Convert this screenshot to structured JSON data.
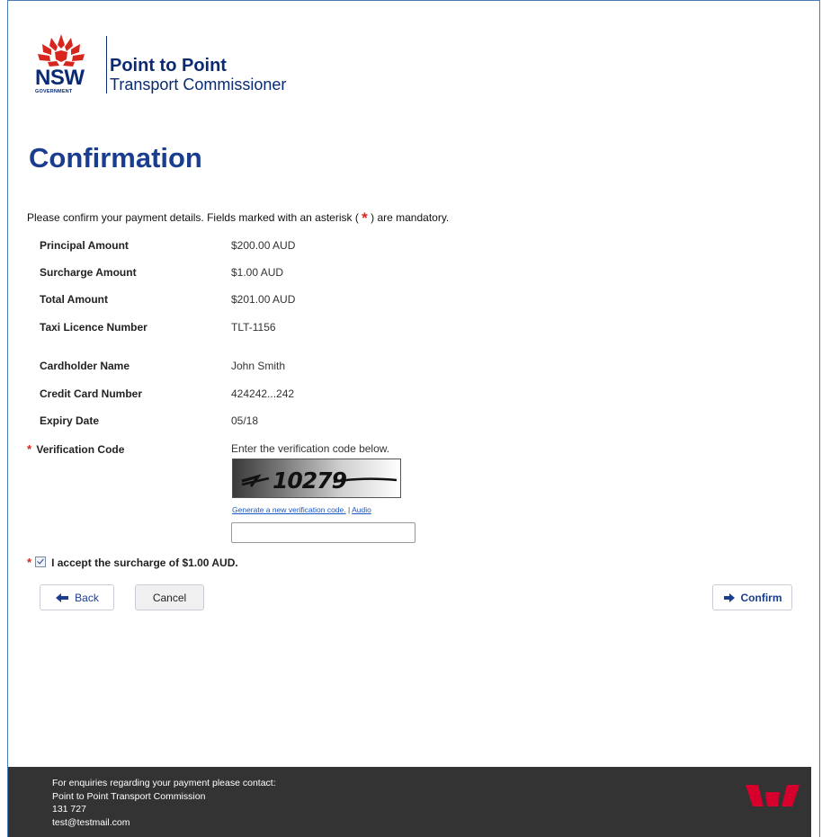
{
  "header": {
    "logo_nsw": "NSW",
    "logo_government": "GOVERNMENT",
    "logo_title": "Point to Point",
    "logo_subtitle": "Transport Commissioner"
  },
  "page": {
    "title": "Confirmation",
    "intro_before": "Please confirm your payment details. Fields marked with an asterisk ( ",
    "intro_star": "*",
    "intro_after": " ) are mandatory."
  },
  "details": [
    {
      "label": "Principal Amount",
      "value": "$200.00 AUD"
    },
    {
      "label": "Surcharge Amount",
      "value": "$1.00 AUD"
    },
    {
      "label": "Total Amount",
      "value": "$201.00 AUD"
    },
    {
      "label": "Taxi Licence Number",
      "value": "TLT-1156"
    },
    {
      "label": "Cardholder Name",
      "value": "John Smith"
    },
    {
      "label": "Credit Card Number",
      "value": "424242...242"
    },
    {
      "label": "Expiry Date",
      "value": "05/18"
    }
  ],
  "verification": {
    "required_mark": "*",
    "label": "Verification Code",
    "instructions": "Enter the verification code below.",
    "captcha_text": "10279",
    "generate_link": "Generate a new verification code.",
    "separator": " | ",
    "audio_link": "Audio",
    "input_value": ""
  },
  "accept": {
    "required_mark": "*",
    "label": "I accept the surcharge of $1.00 AUD.",
    "checked": true
  },
  "buttons": {
    "back": "Back",
    "cancel": "Cancel",
    "confirm": "Confirm"
  },
  "footer": {
    "line1": "For enquiries regarding your payment please contact:",
    "line2": "Point to Point Transport Commission",
    "line3": "131 727",
    "line4": "test@testmail.com"
  },
  "colors": {
    "brand_navy": "#1b3d8f",
    "required_red": "#d7261e",
    "footer_bg": "#333333",
    "bank_red": "#d5002b"
  }
}
